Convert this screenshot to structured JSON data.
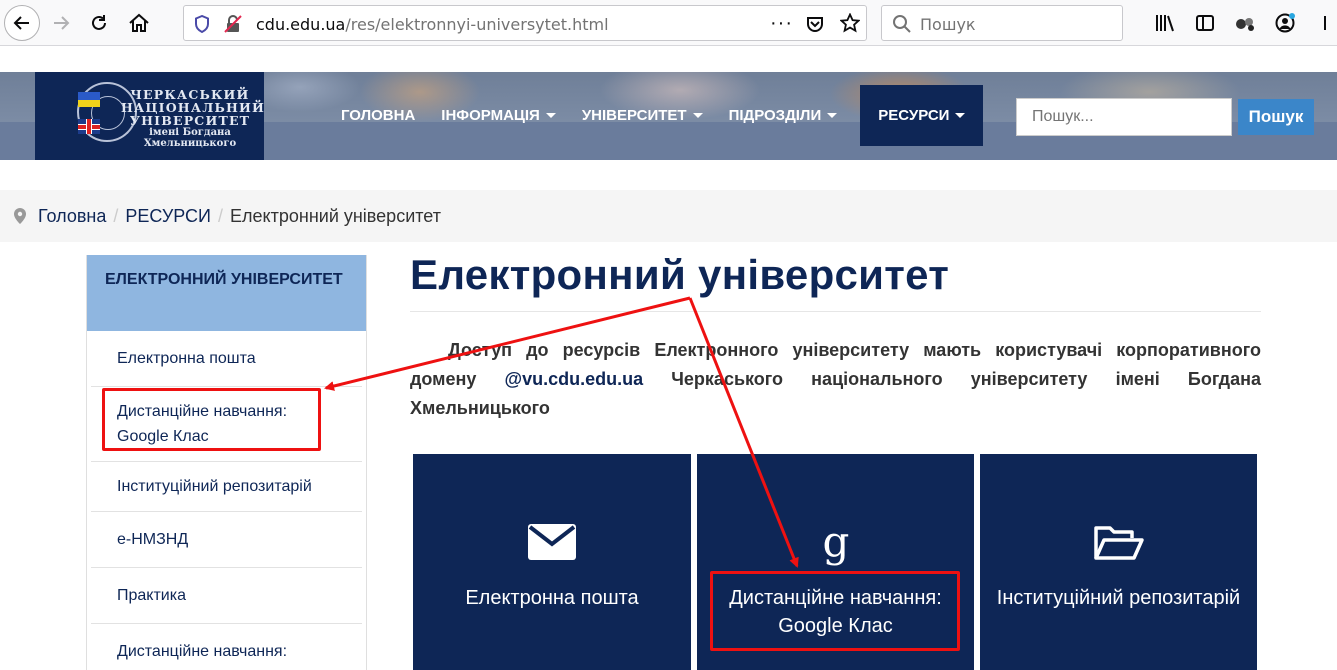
{
  "browser": {
    "url_domain": "cdu.edu.ua",
    "url_path": "/res/elektronnyi-universytet.html",
    "search_placeholder": "Пошук",
    "icons": [
      "back-icon",
      "forward-icon",
      "reload-icon",
      "home-icon",
      "shield-icon",
      "insecure-lock-icon",
      "page-actions-icon",
      "pocket-icon",
      "bookmark-star-icon",
      "library-icon",
      "sidebar-icon",
      "extensions-icon",
      "account-icon",
      "menu-icon"
    ]
  },
  "site": {
    "logo_line1": "ЧЕРКАСЬКИЙ",
    "logo_line2": "НАЦІОНАЛЬНИЙ",
    "logo_line3": "УНІВЕРСИТЕТ",
    "logo_line4": "імені Богдана Хмельницького",
    "nav": [
      {
        "label": "ГОЛОВНА",
        "dropdown": false
      },
      {
        "label": "ІНФОРМАЦІЯ",
        "dropdown": true
      },
      {
        "label": "УНІВЕРСИТЕТ",
        "dropdown": true
      },
      {
        "label": "ПІДРОЗДІЛИ",
        "dropdown": true
      },
      {
        "label": "РЕСУРСИ",
        "dropdown": true,
        "active": true
      }
    ],
    "search_placeholder": "Пошук...",
    "search_button": "Пошук",
    "accent": "#0e2656",
    "button_color": "#3b86c9"
  },
  "breadcrumb": {
    "home": "Головна",
    "section": "РЕСУРСИ",
    "current": "Електронний університет"
  },
  "sidebar": {
    "heading": "ЕЛЕКТРОННИЙ УНІВЕРСИТЕТ",
    "items": [
      "Електронна пошта",
      "Дистанційне навчання: Google Клас",
      "Інституційний репозитарій",
      "е-НМЗНД",
      "Практика",
      "Дистанційне навчання:"
    ]
  },
  "main": {
    "title": "Електронний університет",
    "intro_before": "Доступ до ресурсів Електронного університету мають користувачі корпоративного домену ",
    "intro_link": "@vu.cdu.edu.ua",
    "intro_after": " Черкаського національного університету імені Богдана Хмельницького",
    "tiles": [
      {
        "label": "Електронна пошта",
        "icon": "envelope-icon"
      },
      {
        "label": "Дистанційне навчання: Google Клас",
        "icon": "google-icon"
      },
      {
        "label": "Інституційний репозитарій",
        "icon": "folder-open-icon"
      }
    ]
  },
  "annotations": {
    "highlight_color": "#ee1111"
  }
}
